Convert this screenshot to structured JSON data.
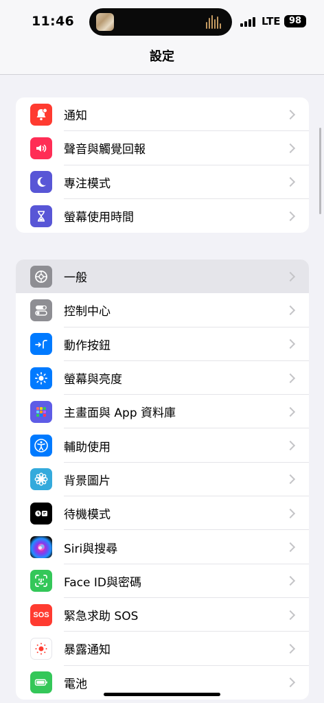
{
  "status_bar": {
    "time": "11:46",
    "network": "LTE",
    "battery": "98"
  },
  "header": {
    "title": "設定"
  },
  "groups": [
    {
      "items": [
        {
          "label": "通知",
          "icon": "bell-icon",
          "color": "#ff3b30"
        },
        {
          "label": "聲音與觸覺回報",
          "icon": "speaker-icon",
          "color": "#ff2d55"
        },
        {
          "label": "專注模式",
          "icon": "moon-icon",
          "color": "#5856d6"
        },
        {
          "label": "螢幕使用時間",
          "icon": "hourglass-icon",
          "color": "#5856d6"
        }
      ]
    },
    {
      "items": [
        {
          "label": "一般",
          "icon": "gear-icon",
          "color": "#8e8e93",
          "highlighted": true
        },
        {
          "label": "控制中心",
          "icon": "toggles-icon",
          "color": "#8e8e93"
        },
        {
          "label": "動作按鈕",
          "icon": "action-button-icon",
          "color": "#007aff"
        },
        {
          "label": "螢幕與亮度",
          "icon": "sun-icon",
          "color": "#007aff"
        },
        {
          "label": "主畫面與 App 資料庫",
          "icon": "app-grid-icon",
          "color": "#5e5ce6"
        },
        {
          "label": "輔助使用",
          "icon": "accessibility-icon",
          "color": "#007aff"
        },
        {
          "label": "背景圖片",
          "icon": "flower-icon",
          "color": "#34aadc"
        },
        {
          "label": "待機模式",
          "icon": "standby-icon",
          "color": "#000000"
        },
        {
          "label": "Siri與搜尋",
          "icon": "siri-icon",
          "color": "#1c1c1e"
        },
        {
          "label": "Face ID與密碼",
          "icon": "face-id-icon",
          "color": "#34c759"
        },
        {
          "label": "緊急求助 SOS",
          "icon": "sos-icon",
          "color": "#ff3b30"
        },
        {
          "label": "暴露通知",
          "icon": "exposure-icon",
          "color": "#ffffff"
        },
        {
          "label": "電池",
          "icon": "battery-icon",
          "color": "#34c759"
        }
      ]
    }
  ]
}
